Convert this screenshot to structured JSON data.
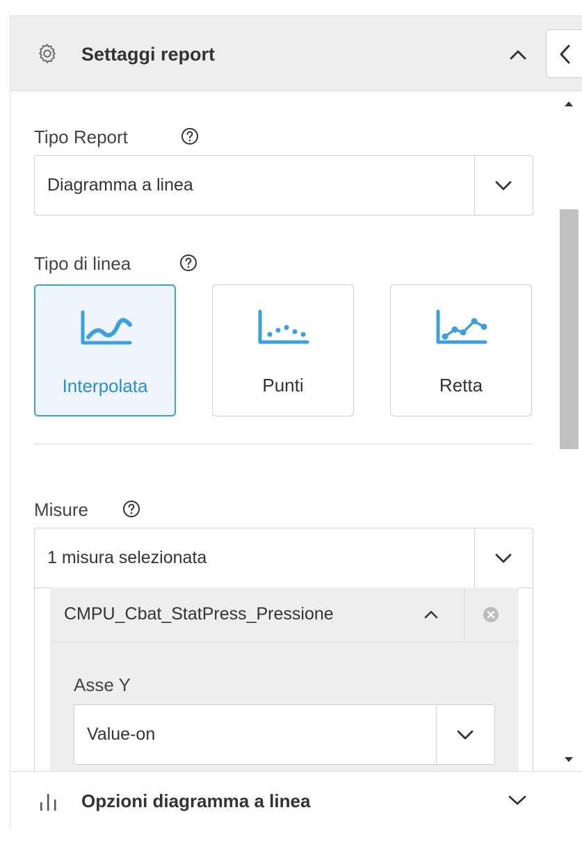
{
  "header": {
    "title": "Settaggi report"
  },
  "tipo_report": {
    "label": "Tipo Report",
    "value": "Diagramma a linea"
  },
  "tipo_linea": {
    "label": "Tipo di linea",
    "options": [
      {
        "label": "Interpolata",
        "icon": "smooth-line-chart-icon",
        "selected": true
      },
      {
        "label": "Punti",
        "icon": "dots-chart-icon",
        "selected": false
      },
      {
        "label": "Retta",
        "icon": "straight-line-chart-icon",
        "selected": false
      }
    ]
  },
  "misure": {
    "label": "Misure",
    "value": "1 misura selezionata",
    "items": [
      {
        "name": "CMPU_Cbat_StatPress_Pressione",
        "asse_label": "Asse Y",
        "asse_value": "Value-on"
      }
    ]
  },
  "footer": {
    "title": "Opzioni diagramma a linea"
  },
  "colors": {
    "accent": "#3aa0df",
    "accent_text": "#2a8fd6",
    "selected_bg": "#eef5ff",
    "header_bg": "#eeeeee"
  }
}
